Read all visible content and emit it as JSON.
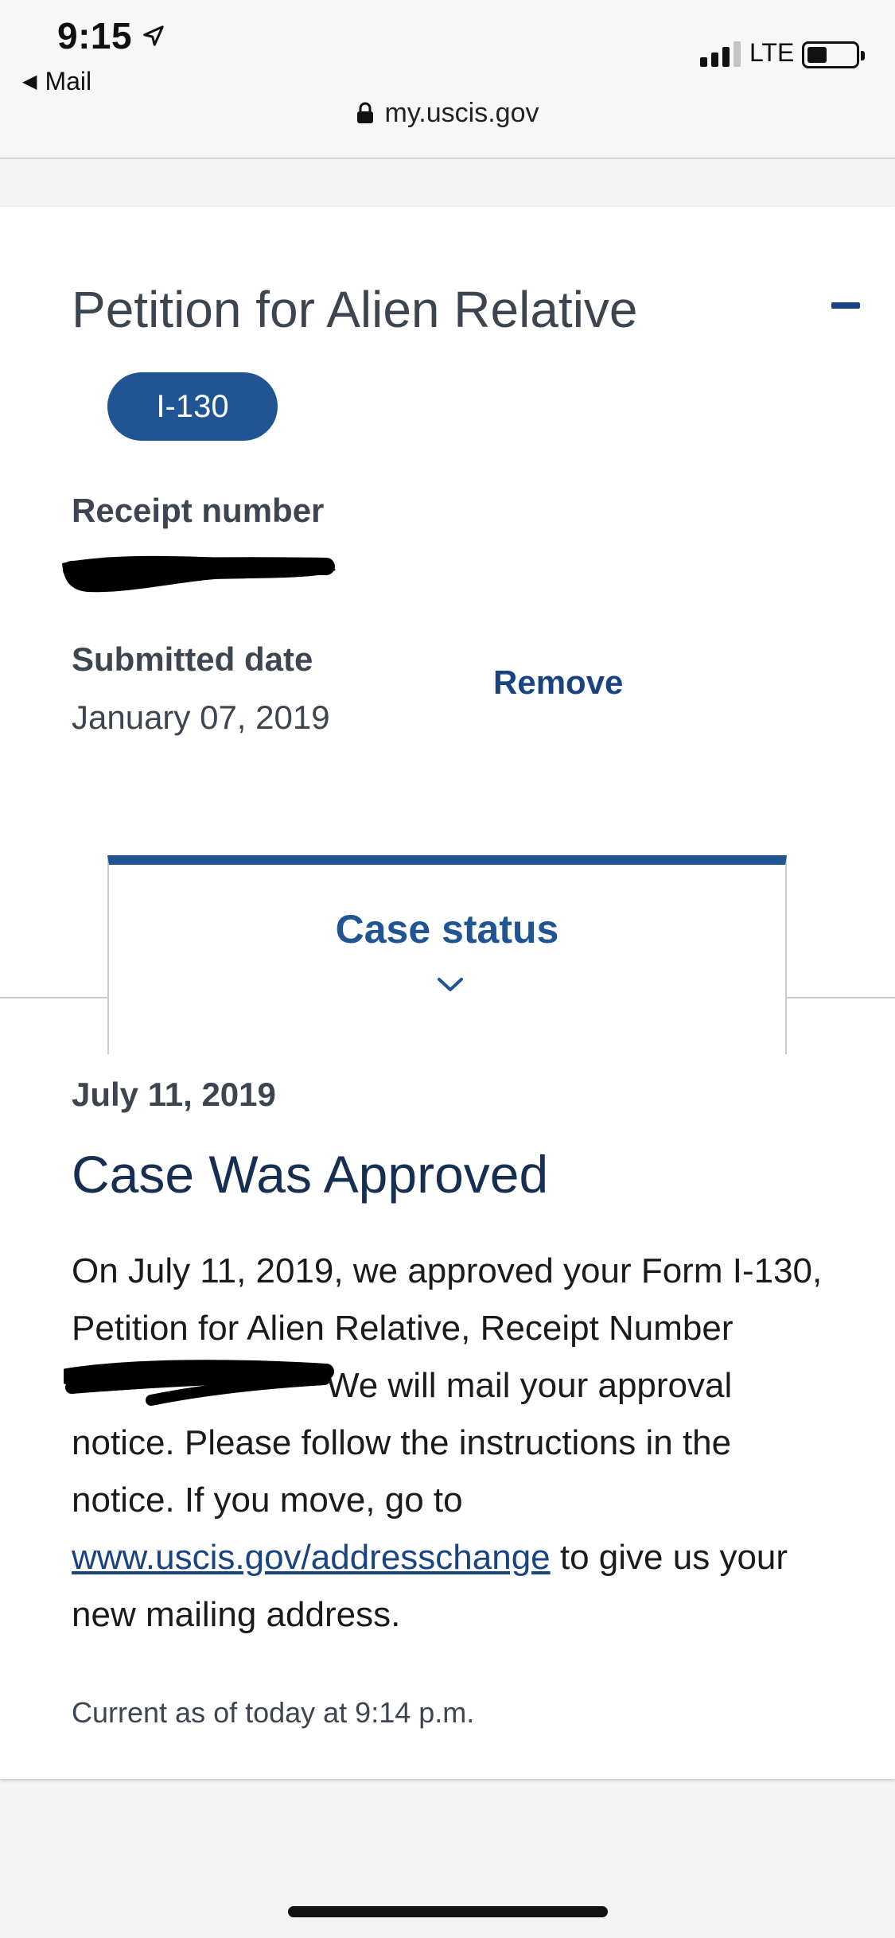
{
  "statusbar": {
    "time": "9:15",
    "back_app": "Mail",
    "carrier": "LTE",
    "url": "my.uscis.gov"
  },
  "case": {
    "title": "Petition for Alien Relative",
    "form_badge": "I-130",
    "receipt_label": "Receipt number",
    "submitted_label": "Submitted date",
    "submitted_value": "January 07, 2019",
    "remove_label": "Remove"
  },
  "tab": {
    "label": "Case status"
  },
  "status": {
    "date": "July 11, 2019",
    "heading": "Case Was Approved",
    "body_part1": "On July 11, 2019, we approved your Form I-130, Petition for Alien Relative, Receipt Number ",
    "body_part2": "We will mail your approval notice. Please follow the instructions in the notice. If you move, go to ",
    "link_text": "www.uscis.gov/addresschange",
    "body_part3": " to give us your new mailing address.",
    "updated": "Current as of today at 9:14 p.m."
  },
  "colors": {
    "accent": "#205493",
    "heading": "#162e51",
    "text": "#3d4551"
  },
  "icons": [
    "location-arrow-icon",
    "back-triangle-icon",
    "signal-icon",
    "battery-icon",
    "lock-icon",
    "collapse-minus-icon",
    "chevron-down-icon"
  ]
}
